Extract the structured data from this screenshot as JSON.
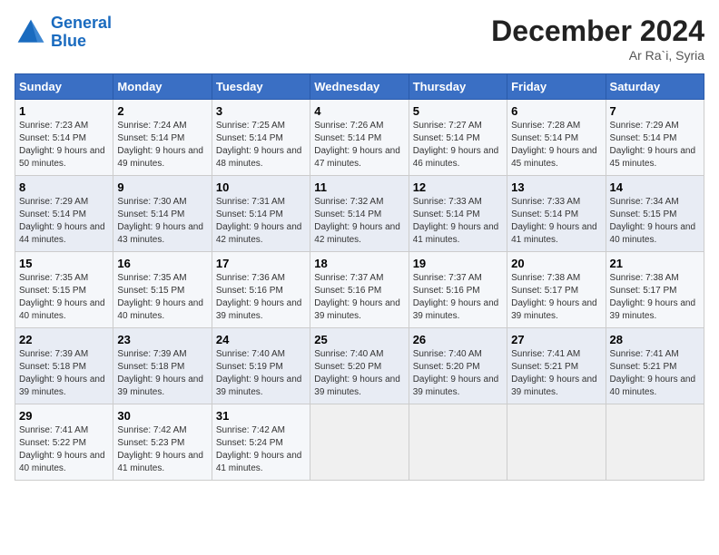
{
  "logo": {
    "line1": "General",
    "line2": "Blue"
  },
  "title": "December 2024",
  "location": "Ar Ra`i, Syria",
  "weekdays": [
    "Sunday",
    "Monday",
    "Tuesday",
    "Wednesday",
    "Thursday",
    "Friday",
    "Saturday"
  ],
  "weeks": [
    [
      {
        "day": "1",
        "sunrise": "Sunrise: 7:23 AM",
        "sunset": "Sunset: 5:14 PM",
        "daylight": "Daylight: 9 hours and 50 minutes."
      },
      {
        "day": "2",
        "sunrise": "Sunrise: 7:24 AM",
        "sunset": "Sunset: 5:14 PM",
        "daylight": "Daylight: 9 hours and 49 minutes."
      },
      {
        "day": "3",
        "sunrise": "Sunrise: 7:25 AM",
        "sunset": "Sunset: 5:14 PM",
        "daylight": "Daylight: 9 hours and 48 minutes."
      },
      {
        "day": "4",
        "sunrise": "Sunrise: 7:26 AM",
        "sunset": "Sunset: 5:14 PM",
        "daylight": "Daylight: 9 hours and 47 minutes."
      },
      {
        "day": "5",
        "sunrise": "Sunrise: 7:27 AM",
        "sunset": "Sunset: 5:14 PM",
        "daylight": "Daylight: 9 hours and 46 minutes."
      },
      {
        "day": "6",
        "sunrise": "Sunrise: 7:28 AM",
        "sunset": "Sunset: 5:14 PM",
        "daylight": "Daylight: 9 hours and 45 minutes."
      },
      {
        "day": "7",
        "sunrise": "Sunrise: 7:29 AM",
        "sunset": "Sunset: 5:14 PM",
        "daylight": "Daylight: 9 hours and 45 minutes."
      }
    ],
    [
      {
        "day": "8",
        "sunrise": "Sunrise: 7:29 AM",
        "sunset": "Sunset: 5:14 PM",
        "daylight": "Daylight: 9 hours and 44 minutes."
      },
      {
        "day": "9",
        "sunrise": "Sunrise: 7:30 AM",
        "sunset": "Sunset: 5:14 PM",
        "daylight": "Daylight: 9 hours and 43 minutes."
      },
      {
        "day": "10",
        "sunrise": "Sunrise: 7:31 AM",
        "sunset": "Sunset: 5:14 PM",
        "daylight": "Daylight: 9 hours and 42 minutes."
      },
      {
        "day": "11",
        "sunrise": "Sunrise: 7:32 AM",
        "sunset": "Sunset: 5:14 PM",
        "daylight": "Daylight: 9 hours and 42 minutes."
      },
      {
        "day": "12",
        "sunrise": "Sunrise: 7:33 AM",
        "sunset": "Sunset: 5:14 PM",
        "daylight": "Daylight: 9 hours and 41 minutes."
      },
      {
        "day": "13",
        "sunrise": "Sunrise: 7:33 AM",
        "sunset": "Sunset: 5:14 PM",
        "daylight": "Daylight: 9 hours and 41 minutes."
      },
      {
        "day": "14",
        "sunrise": "Sunrise: 7:34 AM",
        "sunset": "Sunset: 5:15 PM",
        "daylight": "Daylight: 9 hours and 40 minutes."
      }
    ],
    [
      {
        "day": "15",
        "sunrise": "Sunrise: 7:35 AM",
        "sunset": "Sunset: 5:15 PM",
        "daylight": "Daylight: 9 hours and 40 minutes."
      },
      {
        "day": "16",
        "sunrise": "Sunrise: 7:35 AM",
        "sunset": "Sunset: 5:15 PM",
        "daylight": "Daylight: 9 hours and 40 minutes."
      },
      {
        "day": "17",
        "sunrise": "Sunrise: 7:36 AM",
        "sunset": "Sunset: 5:16 PM",
        "daylight": "Daylight: 9 hours and 39 minutes."
      },
      {
        "day": "18",
        "sunrise": "Sunrise: 7:37 AM",
        "sunset": "Sunset: 5:16 PM",
        "daylight": "Daylight: 9 hours and 39 minutes."
      },
      {
        "day": "19",
        "sunrise": "Sunrise: 7:37 AM",
        "sunset": "Sunset: 5:16 PM",
        "daylight": "Daylight: 9 hours and 39 minutes."
      },
      {
        "day": "20",
        "sunrise": "Sunrise: 7:38 AM",
        "sunset": "Sunset: 5:17 PM",
        "daylight": "Daylight: 9 hours and 39 minutes."
      },
      {
        "day": "21",
        "sunrise": "Sunrise: 7:38 AM",
        "sunset": "Sunset: 5:17 PM",
        "daylight": "Daylight: 9 hours and 39 minutes."
      }
    ],
    [
      {
        "day": "22",
        "sunrise": "Sunrise: 7:39 AM",
        "sunset": "Sunset: 5:18 PM",
        "daylight": "Daylight: 9 hours and 39 minutes."
      },
      {
        "day": "23",
        "sunrise": "Sunrise: 7:39 AM",
        "sunset": "Sunset: 5:18 PM",
        "daylight": "Daylight: 9 hours and 39 minutes."
      },
      {
        "day": "24",
        "sunrise": "Sunrise: 7:40 AM",
        "sunset": "Sunset: 5:19 PM",
        "daylight": "Daylight: 9 hours and 39 minutes."
      },
      {
        "day": "25",
        "sunrise": "Sunrise: 7:40 AM",
        "sunset": "Sunset: 5:20 PM",
        "daylight": "Daylight: 9 hours and 39 minutes."
      },
      {
        "day": "26",
        "sunrise": "Sunrise: 7:40 AM",
        "sunset": "Sunset: 5:20 PM",
        "daylight": "Daylight: 9 hours and 39 minutes."
      },
      {
        "day": "27",
        "sunrise": "Sunrise: 7:41 AM",
        "sunset": "Sunset: 5:21 PM",
        "daylight": "Daylight: 9 hours and 39 minutes."
      },
      {
        "day": "28",
        "sunrise": "Sunrise: 7:41 AM",
        "sunset": "Sunset: 5:21 PM",
        "daylight": "Daylight: 9 hours and 40 minutes."
      }
    ],
    [
      {
        "day": "29",
        "sunrise": "Sunrise: 7:41 AM",
        "sunset": "Sunset: 5:22 PM",
        "daylight": "Daylight: 9 hours and 40 minutes."
      },
      {
        "day": "30",
        "sunrise": "Sunrise: 7:42 AM",
        "sunset": "Sunset: 5:23 PM",
        "daylight": "Daylight: 9 hours and 41 minutes."
      },
      {
        "day": "31",
        "sunrise": "Sunrise: 7:42 AM",
        "sunset": "Sunset: 5:24 PM",
        "daylight": "Daylight: 9 hours and 41 minutes."
      },
      null,
      null,
      null,
      null
    ]
  ]
}
